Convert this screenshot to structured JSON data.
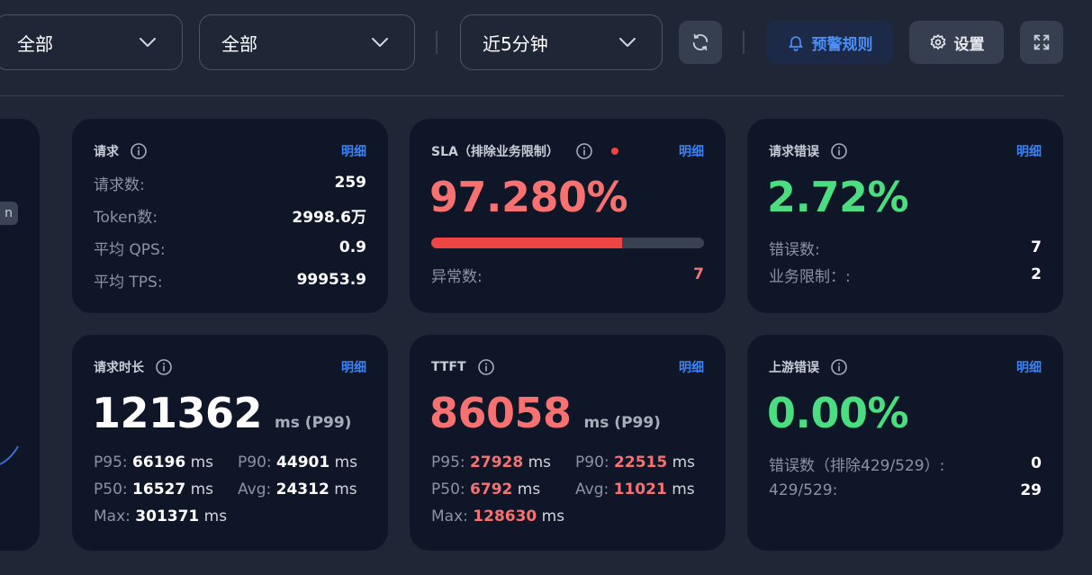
{
  "toolbar": {
    "filter_1": "全部",
    "filter_2": "全部",
    "time_range": "近5分钟",
    "alert_rules_label": "预警规则",
    "settings_label": "设置"
  },
  "partial_card": {
    "pill_text": "n"
  },
  "cards": {
    "requests": {
      "title": "请求",
      "detail": "明细",
      "rows": [
        {
          "label": "请求数:",
          "value": "259"
        },
        {
          "label": "Token数:",
          "value": "2998.6万"
        },
        {
          "label": "平均 QPS:",
          "value": "0.9"
        },
        {
          "label": "平均 TPS:",
          "value": "99953.9"
        }
      ]
    },
    "sla": {
      "title": "SLA（排除业务限制）",
      "detail": "明细",
      "value": "97.280%",
      "progress": 0.7,
      "abnormal_label": "异常数:",
      "abnormal_value": "7"
    },
    "request_errors": {
      "title": "请求错误",
      "detail": "明细",
      "value": "2.72%",
      "rows": [
        {
          "label": "错误数:",
          "value": "7"
        },
        {
          "label": "业务限制：:",
          "value": "2"
        }
      ]
    },
    "duration": {
      "title": "请求时长",
      "detail": "明细",
      "value": "121362",
      "unit": "ms (P99)",
      "p95_label": "P95:",
      "p95": "66196",
      "p90_label": "P90:",
      "p90": "44901",
      "p50_label": "P50:",
      "p50": "16527",
      "avg_label": "Avg:",
      "avg": "24312",
      "max_label": "Max:",
      "max": "301371",
      "ms": "ms"
    },
    "ttft": {
      "title": "TTFT",
      "detail": "明细",
      "value": "86058",
      "unit": "ms (P99)",
      "p95_label": "P95:",
      "p95": "27928",
      "p90_label": "P90:",
      "p90": "22515",
      "p50_label": "P50:",
      "p50": "6792",
      "avg_label": "Avg:",
      "avg": "11021",
      "max_label": "Max:",
      "max": "128630",
      "ms": "ms"
    },
    "upstream_errors": {
      "title": "上游错误",
      "detail": "明细",
      "value": "0.00%",
      "rows": [
        {
          "label": "错误数（排除429/529）:",
          "value": "0"
        },
        {
          "label": "429/529:",
          "value": "29"
        }
      ]
    }
  },
  "colors": {
    "background": "#1f2737",
    "card": "#0f1628",
    "accent_blue": "#3b82f6",
    "danger": "#f87171",
    "success": "#4ade80"
  }
}
